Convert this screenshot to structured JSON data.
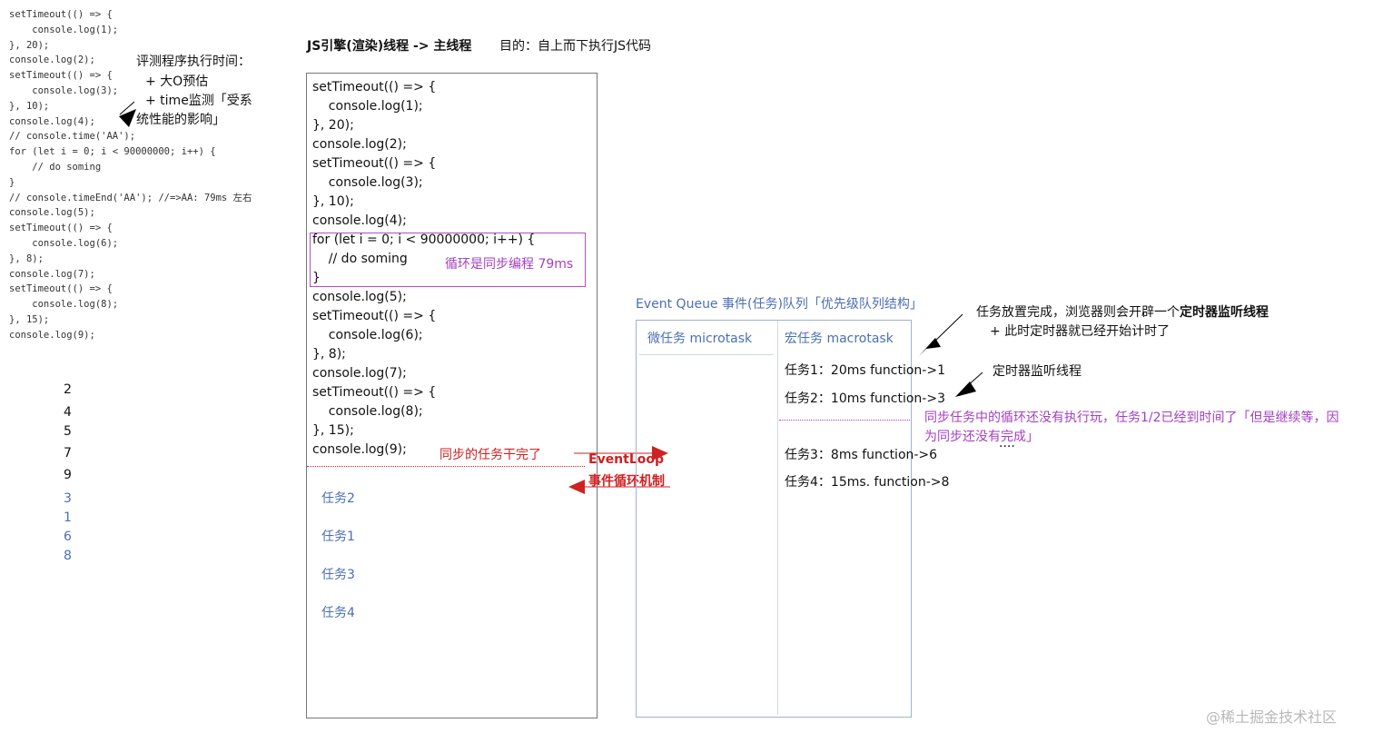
{
  "left_code": [
    "setTimeout(() => {",
    "    console.log(1);",
    "}, 20);",
    "console.log(2);",
    "setTimeout(() => {",
    "    console.log(3);",
    "}, 10);",
    "console.log(4);",
    "// console.time('AA');",
    "for (let i = 0; i < 90000000; i++) {",
    "    // do soming",
    "}",
    "// console.timeEnd('AA'); //=>AA: 79ms 左右",
    "console.log(5);",
    "setTimeout(() => {",
    "    console.log(6);",
    "}, 8);",
    "console.log(7);",
    "setTimeout(() => {",
    "    console.log(8);",
    "}, 15);",
    "console.log(9);"
  ],
  "measure_note": {
    "title": "评测程序执行时间：",
    "line1": "+ 大O预估",
    "line2": "+ time监测「受系",
    "line3": "统性能的影响」"
  },
  "output_sync": [
    "2",
    "4",
    "5",
    "7",
    "9"
  ],
  "output_async": [
    "3",
    "1",
    "6",
    "8"
  ],
  "header": {
    "title": "JS引擎(渲染)线程 -> 主线程",
    "goal": "目的：自上而下执行JS代码"
  },
  "main_code": [
    "setTimeout(() => {",
    "    console.log(1);",
    "}, 20);",
    "console.log(2);",
    "setTimeout(() => {",
    "    console.log(3);",
    "}, 10);",
    "console.log(4);",
    "for (let i = 0; i < 90000000; i++) {",
    "    // do soming",
    "}",
    "console.log(5);",
    "setTimeout(() => {",
    "    console.log(6);",
    "}, 8);",
    "console.log(7);",
    "setTimeout(() => {",
    "    console.log(8);",
    "}, 15);",
    "console.log(9);"
  ],
  "loop_note": "循环是同步编程   79ms",
  "sync_done": "同步的任务干完了",
  "event_loop": {
    "line1": "EventLoop",
    "line2": "事件循环机制"
  },
  "main_tasks": [
    "任务2",
    "任务1",
    "任务3",
    "任务4"
  ],
  "event_queue": {
    "title": "Event Queue 事件(任务)队列「优先级队列结构」",
    "micro_header": "微任务 microtask",
    "macro_header": "宏任务   macrotask",
    "macro_items": [
      "任务1：20ms   function->1",
      "任务2：10ms   function->3",
      "任务3：8ms function->6",
      "任务4：15ms. function->8"
    ]
  },
  "timer_note": {
    "line1_prefix": "任务放置完成，浏览器则会开辟一个",
    "line1_bold": "定时器监听线程",
    "line2": "+ 此时定时器就已经开始计时了",
    "monitor": "定时器监听线程"
  },
  "waiting_note": {
    "line1": "同步任务中的循环还没有执行玩，任务1/2已经到时间了「但是继续等，因",
    "line2": "为同步还没有完成」",
    "ellipsis": "...."
  },
  "watermark": "@稀土掘金技术社区",
  "colors": {
    "accent_blue": "#4a6fb5",
    "red": "#d02020",
    "purple": "#a33fc0"
  }
}
